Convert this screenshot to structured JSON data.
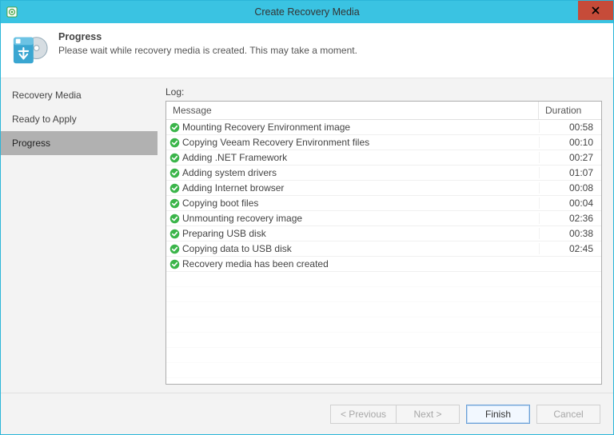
{
  "window": {
    "title": "Create Recovery Media"
  },
  "header": {
    "heading": "Progress",
    "subtitle": "Please wait while recovery media is created. This may take a moment."
  },
  "sidebar": {
    "items": [
      {
        "label": "Recovery Media",
        "active": false
      },
      {
        "label": "Ready to Apply",
        "active": false
      },
      {
        "label": "Progress",
        "active": true
      }
    ]
  },
  "log": {
    "label": "Log:",
    "col_message": "Message",
    "col_duration": "Duration",
    "rows": [
      {
        "msg": "Mounting Recovery Environment image",
        "dur": "00:58"
      },
      {
        "msg": "Copying Veeam Recovery Environment files",
        "dur": "00:10"
      },
      {
        "msg": "Adding .NET Framework",
        "dur": "00:27"
      },
      {
        "msg": "Adding system drivers",
        "dur": "01:07"
      },
      {
        "msg": "Adding Internet browser",
        "dur": "00:08"
      },
      {
        "msg": "Copying boot files",
        "dur": "00:04"
      },
      {
        "msg": "Unmounting recovery image",
        "dur": "02:36"
      },
      {
        "msg": "Preparing USB disk",
        "dur": "00:38"
      },
      {
        "msg": "Copying data to USB disk",
        "dur": "02:45"
      },
      {
        "msg": "Recovery media has been created",
        "dur": ""
      }
    ]
  },
  "buttons": {
    "previous": "< Previous",
    "next": "Next >",
    "finish": "Finish",
    "cancel": "Cancel"
  }
}
